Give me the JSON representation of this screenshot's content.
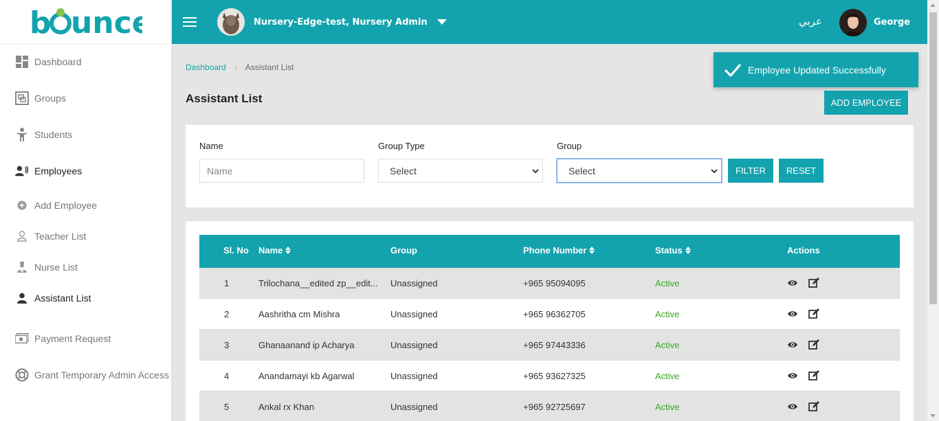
{
  "app": {
    "logo": "bounce"
  },
  "sidebar": {
    "items": [
      {
        "label": "Dashboard"
      },
      {
        "label": "Groups"
      },
      {
        "label": "Students"
      },
      {
        "label": "Employees"
      },
      {
        "label": "Add Employee"
      },
      {
        "label": "Teacher List"
      },
      {
        "label": "Nurse List"
      },
      {
        "label": "Assistant List"
      },
      {
        "label": "Payment Request"
      },
      {
        "label": "Grant Temporary Admin Access"
      }
    ]
  },
  "topbar": {
    "nursery": "Nursery-Edge-test, Nursery Admin",
    "language": "عربي",
    "user": "George"
  },
  "toast": {
    "message": "Employee Updated Successfully"
  },
  "breadcrumb": {
    "home": "Dashboard",
    "current": "Assistant List"
  },
  "page": {
    "title": "Assistant List",
    "add_button": "ADD EMPLOYEE"
  },
  "filters": {
    "name_label": "Name",
    "name_placeholder": "Name",
    "group_type_label": "Group Type",
    "group_type_value": "Select",
    "group_label": "Group",
    "group_value": "Select",
    "filter_button": "FILTER",
    "reset_button": "RESET"
  },
  "table": {
    "headers": {
      "sl": "Sl. No",
      "name": "Name",
      "group": "Group",
      "phone": "Phone Number",
      "status": "Status",
      "actions": "Actions"
    },
    "rows": [
      {
        "sl": "1",
        "name": "Trilochana__edited zp__edit...",
        "group": "Unassigned",
        "phone": "+965 95094095",
        "status": "Active"
      },
      {
        "sl": "2",
        "name": "Aashritha cm Mishra",
        "group": "Unassigned",
        "phone": "+965 96362705",
        "status": "Active"
      },
      {
        "sl": "3",
        "name": "Ghanaanand ip Acharya",
        "group": "Unassigned",
        "phone": "+965 97443336",
        "status": "Active"
      },
      {
        "sl": "4",
        "name": "Anandamayi kb Agarwal",
        "group": "Unassigned",
        "phone": "+965 93627325",
        "status": "Active"
      },
      {
        "sl": "5",
        "name": "Ankal rx Khan",
        "group": "Unassigned",
        "phone": "+965 92725697",
        "status": "Active"
      }
    ]
  },
  "colors": {
    "accent": "#13a3ae",
    "active_status": "#38a821"
  }
}
